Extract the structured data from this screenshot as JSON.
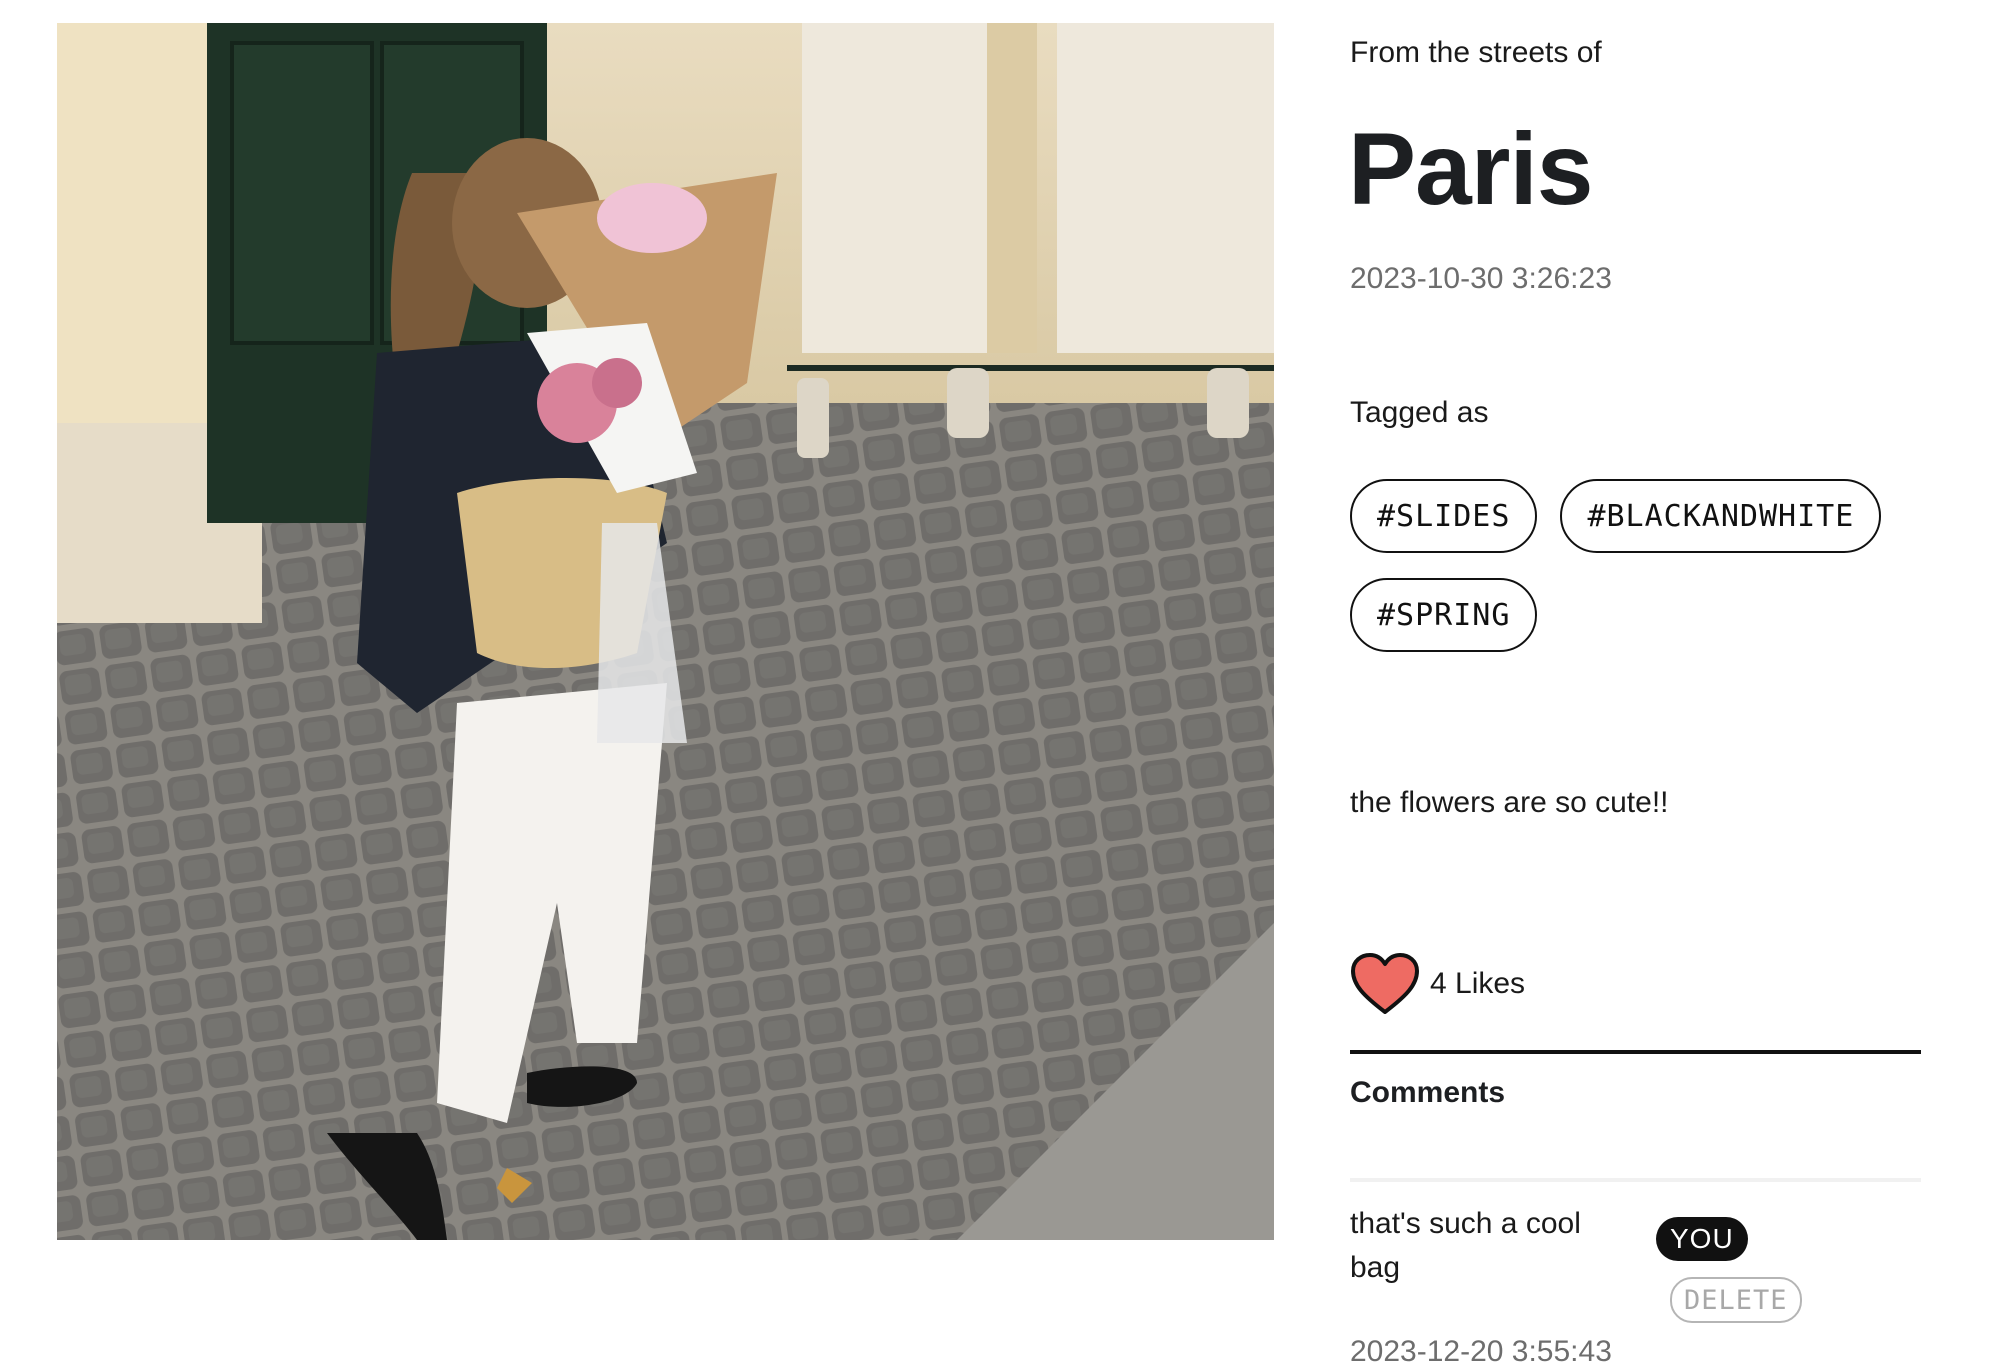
{
  "post": {
    "eyebrow": "From the streets of",
    "city": "Paris",
    "date": "2023-10-30 3:26:23",
    "tagged_label": "Tagged as",
    "tags": [
      "#SLIDES",
      "#BLACKANDWHITE",
      "#SPRING"
    ],
    "caption": "the flowers are so cute!!",
    "likes_label": "4 Likes",
    "photo_icon": "street-photo"
  },
  "comments": {
    "heading": "Comments",
    "items": [
      {
        "text": "that's such a cool bag",
        "badge": "YOU",
        "delete_label": "DELETE",
        "date": "2023-12-20 3:55:43"
      }
    ]
  },
  "colors": {
    "heart": "#ee6b63",
    "text": "#1d1f22",
    "muted": "#6d6d6d"
  }
}
